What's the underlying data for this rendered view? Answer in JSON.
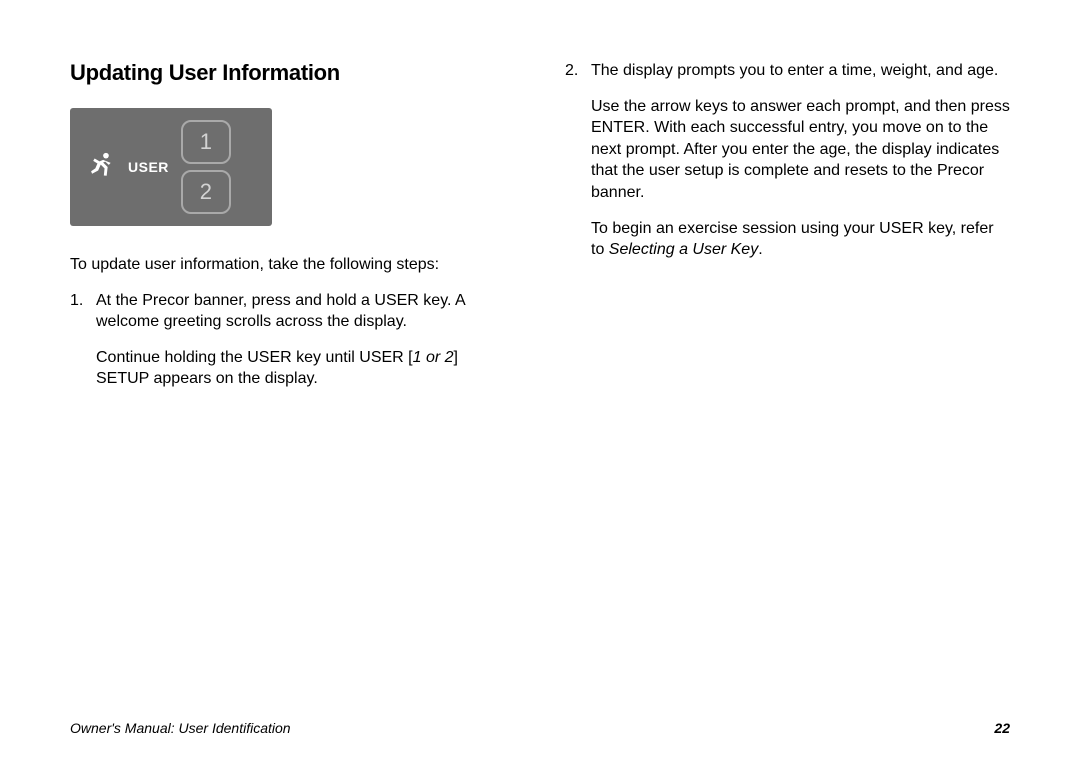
{
  "heading": "Updating User Information",
  "diagram": {
    "user_label": "USER",
    "btn1": "1",
    "btn2": "2"
  },
  "left": {
    "intro": "To update user information, take the following steps:",
    "step1_a": "At the Precor banner, press and hold a USER key. A welcome greeting scrolls across the display.",
    "step1_b_pre": "Continue holding the USER key until USER [",
    "step1_b_em": "1 or 2",
    "step1_b_post": "] SETUP appears on the display."
  },
  "right": {
    "step2_a": "The display prompts you to enter a time, weight, and age.",
    "step2_b": "Use the arrow keys to answer each prompt, and then press ENTER. With each successful entry, you move on to the next prompt. After you enter the age, the display indicates that the user setup is complete and resets to the Precor banner.",
    "step2_c_pre": "To begin an exercise session using your USER key, refer to ",
    "step2_c_em": "Selecting a User Key",
    "step2_c_post": "."
  },
  "footer": {
    "left": "Owner's Manual: User Identification",
    "page": "22"
  }
}
